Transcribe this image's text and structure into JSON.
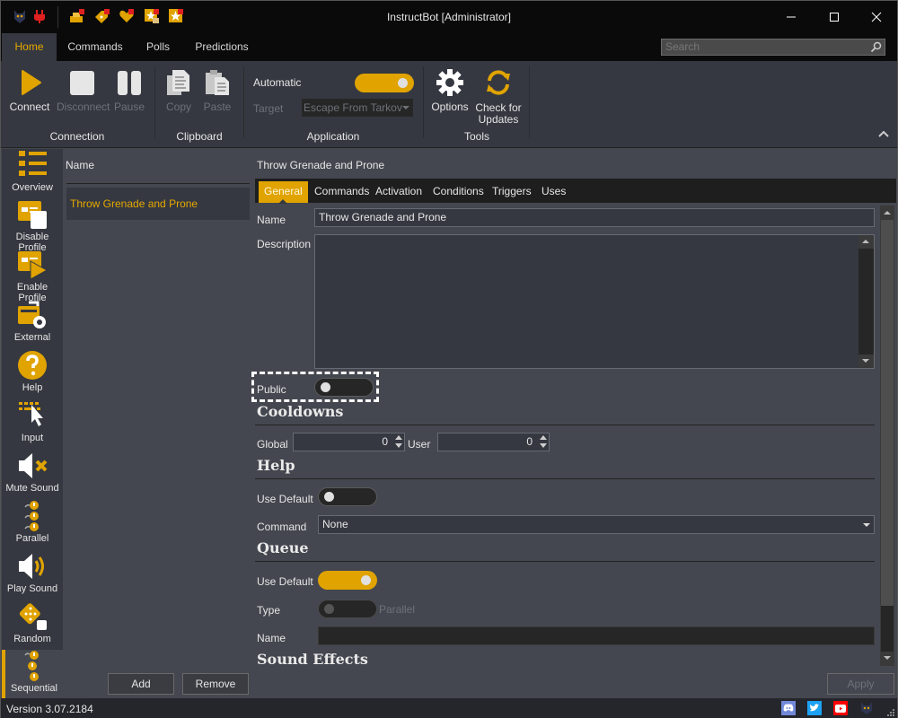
{
  "window": {
    "title": "InstructBot [Administrator]",
    "controls": [
      "minimize",
      "maximize",
      "close"
    ]
  },
  "quick_access": [
    {
      "name": "app-logo-icon"
    },
    {
      "name": "plug-icon"
    },
    {
      "name": "coins-icon"
    },
    {
      "name": "tag-icon"
    },
    {
      "name": "heart-icon"
    },
    {
      "name": "star-gift-icon"
    },
    {
      "name": "star-icon"
    }
  ],
  "menu_tabs": [
    {
      "label": "Home",
      "active": true
    },
    {
      "label": "Commands",
      "active": false
    },
    {
      "label": "Polls",
      "active": false
    },
    {
      "label": "Predictions",
      "active": false
    }
  ],
  "search": {
    "placeholder": "Search",
    "value": ""
  },
  "ribbon": {
    "groups": [
      {
        "label": "Connection",
        "buttons": [
          {
            "label": "Connect",
            "icon": "play-icon",
            "enabled": true
          },
          {
            "label": "Disconnect",
            "icon": "stop-icon",
            "enabled": false
          },
          {
            "label": "Pause",
            "icon": "pause-icon",
            "enabled": false
          }
        ]
      },
      {
        "label": "Clipboard",
        "buttons": [
          {
            "label": "Copy",
            "icon": "copy-icon",
            "enabled": false
          },
          {
            "label": "Paste",
            "icon": "paste-icon",
            "enabled": false
          }
        ]
      },
      {
        "label": "Application",
        "automatic_label": "Automatic",
        "automatic_on": true,
        "target_label": "Target",
        "target_value": "Escape From Tarkov"
      },
      {
        "label": "Tools",
        "buttons": [
          {
            "label": "Options",
            "icon": "gear-icon",
            "enabled": true
          },
          {
            "label": "Check for Updates",
            "label_line1": "Check for",
            "label_line2": "Updates",
            "icon": "refresh-icon",
            "enabled": true
          }
        ]
      }
    ]
  },
  "sidebar": {
    "items": [
      {
        "label": "Overview",
        "icon": "overview-icon"
      },
      {
        "label": "Disable Profile",
        "icon": "disable-profile-icon"
      },
      {
        "label": "Enable Profile",
        "icon": "enable-profile-icon"
      },
      {
        "label": "External",
        "icon": "external-icon"
      },
      {
        "label": "Help",
        "icon": "help-icon"
      },
      {
        "label": "Input",
        "icon": "input-icon"
      },
      {
        "label": "Mute Sound",
        "icon": "mute-sound-icon"
      },
      {
        "label": "Parallel",
        "icon": "parallel-icon"
      },
      {
        "label": "Play Sound",
        "icon": "play-sound-icon"
      },
      {
        "label": "Random",
        "icon": "random-icon"
      },
      {
        "label": "Sequential",
        "icon": "sequential-icon",
        "active": true
      }
    ]
  },
  "list": {
    "header": "Name",
    "rows": [
      "Throw Grenade and Prone"
    ],
    "add_label": "Add",
    "remove_label": "Remove"
  },
  "detail": {
    "title": "Throw Grenade and Prone",
    "tabs": [
      {
        "label": "General",
        "active": true
      },
      {
        "label": "Commands"
      },
      {
        "label": "Activation"
      },
      {
        "label": "Conditions"
      },
      {
        "label": "Triggers"
      },
      {
        "label": "Uses"
      }
    ],
    "general": {
      "name_label": "Name",
      "name_value": "Throw Grenade and Prone",
      "description_label": "Description",
      "description_value": "",
      "public_label": "Public",
      "public_on": false
    },
    "cooldowns": {
      "heading": "Cooldowns",
      "global_label": "Global",
      "global_value": "0",
      "user_label": "User",
      "user_value": "0"
    },
    "help": {
      "heading": "Help",
      "use_default_label": "Use Default",
      "use_default_on": false,
      "command_label": "Command",
      "command_value": "None"
    },
    "queue": {
      "heading": "Queue",
      "use_default_label": "Use Default",
      "use_default_on": true,
      "type_label": "Type",
      "type_value": "Parallel",
      "name_label": "Name",
      "name_value": ""
    },
    "sound_effects": {
      "heading": "Sound Effects"
    },
    "apply_label": "Apply"
  },
  "status": {
    "version": "Version 3.07.2184",
    "social": [
      "discord-icon",
      "twitter-icon",
      "youtube-icon",
      "app-logo-icon"
    ]
  },
  "colors": {
    "accent": "#e0a300",
    "background": "#44474f",
    "ribbon": "#353840",
    "titlebar": "#0a0a0a"
  }
}
